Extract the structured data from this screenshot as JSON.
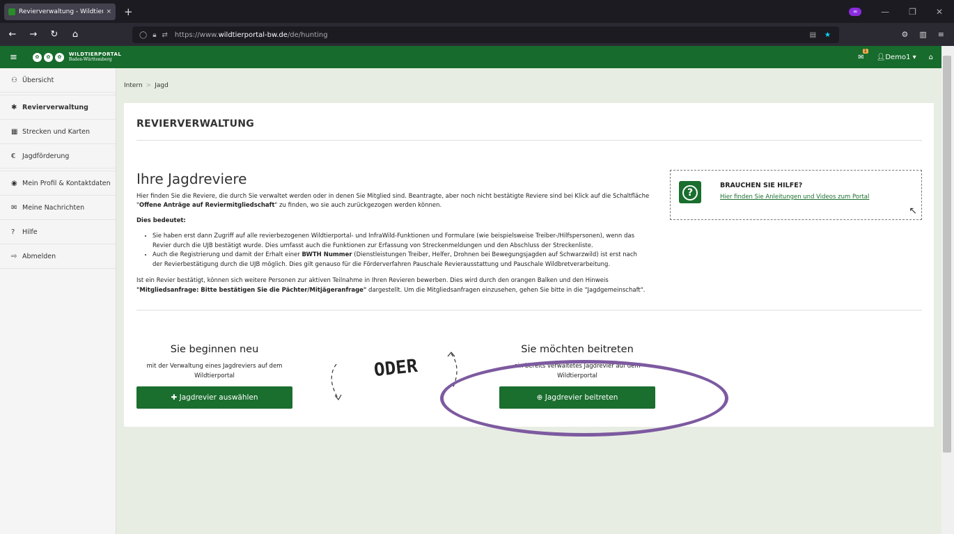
{
  "browser": {
    "tab_title": "Revierverwaltung - Wildtierport",
    "tab_close": "×",
    "new_tab": "+",
    "url_prefix": "https://www.",
    "url_domain": "wildtierportal-bw.de",
    "url_path": "/de/hunting"
  },
  "header": {
    "logo_line1": "WILDTIERPORTAL",
    "logo_line2": "Baden-Württemberg",
    "mail_badge": "1",
    "user": "Demo1 ▾"
  },
  "sidebar": {
    "items": [
      {
        "label": "Übersicht",
        "icon": "dashboard-icon"
      },
      {
        "label": "Revierverwaltung",
        "icon": "gear-icon"
      },
      {
        "label": "Strecken und Karten",
        "icon": "map-icon"
      },
      {
        "label": "Jagdförderung",
        "icon": "euro-icon"
      },
      {
        "label": "Mein Profil & Kontaktdaten",
        "icon": "user-icon"
      },
      {
        "label": "Meine Nachrichten",
        "icon": "envelope-icon"
      },
      {
        "label": "Hilfe",
        "icon": "question-icon"
      },
      {
        "label": "Abmelden",
        "icon": "logout-icon"
      }
    ]
  },
  "breadcrumb": {
    "item1": "Intern",
    "sep": ">",
    "item2": "Jagd"
  },
  "main": {
    "title": "REVIERVERWALTUNG",
    "heading": "Ihre Jagdreviere",
    "intro_a": "Hier finden Sie die Reviere, die durch Sie verwaltet werden oder in denen Sie Mitglied sind. Beantragte, aber noch nicht bestätigte Reviere sind bei Klick auf die Schaltfläche \"",
    "intro_bold": "Offene Anträge auf Reviermitgliedschaft",
    "intro_b": "\" zu finden, wo sie auch zurückgezogen werden können.",
    "dies": "Dies bedeutet:",
    "bullet1": "Sie haben erst dann Zugriff auf alle revierbezogenen Wildtierportal- und InfraWild-Funktionen und Formulare (wie beispielsweise Treiber-/Hilfspersonen), wenn das Revier durch die UJB bestätigt wurde. Dies umfasst auch die Funktionen zur Erfassung von Streckenmeldungen und den Abschluss der Streckenliste.",
    "bullet2_a": "Auch die Registrierung und damit der Erhalt einer ",
    "bullet2_bold": "BWTH Nummer",
    "bullet2_b": " (Dienstleistungen Treiber, Helfer, Drohnen bei Bewegungsjagden auf Schwarzwild) ist erst nach der Revierbestätigung durch die UJB möglich. Dies gilt genauso für die Förderverfahren Pauschale Revierausstattung und Pauschale Wildbretverarbeitung.",
    "outro_a": "Ist ein Revier bestätigt, können sich weitere Personen zur aktiven Teilnahme in Ihren Revieren bewerben. Dies wird durch den orangen Balken und den Hinweis ",
    "outro_bold": "\"Mitgliedsanfrage: Bitte bestätigen Sie die Pächter/Mitjägeranfrage\"",
    "outro_b": " dargestellt. Um die Mitgliedsanfragen einzusehen, gehen Sie bitte in die \"Jagdgemeinschaft\".",
    "help_title": "BRAUCHEN SIE HILFE?",
    "help_link": "Hier finden Sie Anleitungen und Videos zum Portal",
    "new_title": "Sie beginnen neu",
    "new_sub": "mit der Verwaltung eines Jagdreviers auf dem Wildtierportal",
    "new_button": "Jagdrevier auswählen",
    "oder": "ODER",
    "join_title": "Sie möchten beitreten",
    "join_sub": "ein bereits verwaltetes Jagdrevier auf dem Wildtierportal",
    "join_button": "Jagdrevier beitreten"
  },
  "colors": {
    "brand": "#176b2c",
    "button": "#1a6e2e",
    "annotation": "#7d5aa0"
  }
}
